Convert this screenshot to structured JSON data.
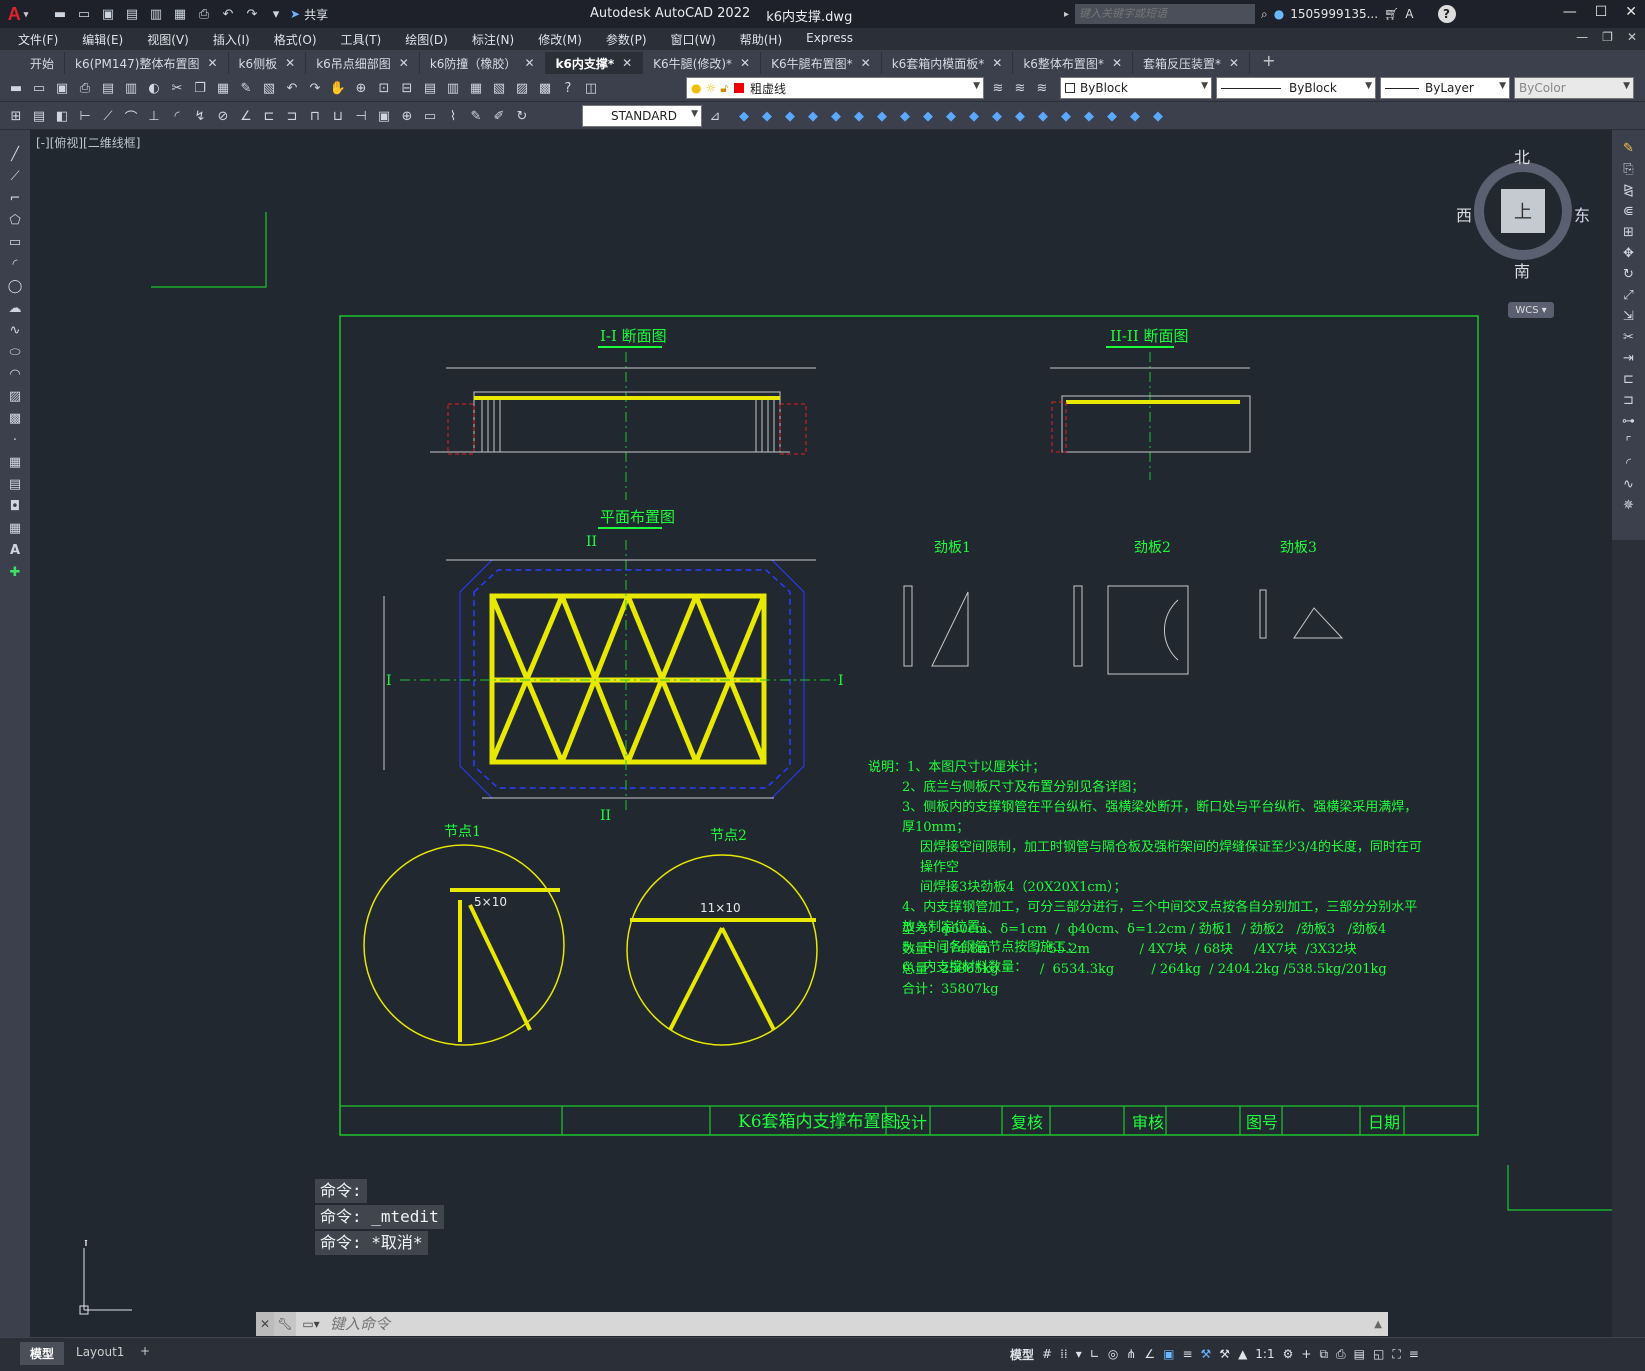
{
  "app": {
    "title": "Autodesk AutoCAD 2022",
    "file": "k6内支撑.dwg",
    "share": "共享",
    "search_placeholder": "键入关键字或短语",
    "user": "1505999135...",
    "help": "?"
  },
  "menus": [
    "文件(F)",
    "编辑(E)",
    "视图(V)",
    "插入(I)",
    "格式(O)",
    "工具(T)",
    "绘图(D)",
    "标注(N)",
    "修改(M)",
    "参数(P)",
    "窗口(W)",
    "帮助(H)",
    "Express"
  ],
  "tabs": [
    {
      "label": "开始",
      "closable": false
    },
    {
      "label": "k6(PM147)整体布置图",
      "closable": true
    },
    {
      "label": "k6侧板",
      "closable": true
    },
    {
      "label": "k6吊点细部图",
      "closable": true
    },
    {
      "label": "k6防撞（橡胶）",
      "closable": true
    },
    {
      "label": "k6内支撑*",
      "closable": true,
      "active": true
    },
    {
      "label": "K6牛腿(修改)*",
      "closable": true
    },
    {
      "label": "K6牛腿布置图*",
      "closable": true
    },
    {
      "label": "k6套箱内模面板*",
      "closable": true
    },
    {
      "label": "k6整体布置图*",
      "closable": true
    },
    {
      "label": "套箱反压装置*",
      "closable": true
    }
  ],
  "toolbar": {
    "layer": "粗虚线",
    "color": "ByBlock",
    "linetype": "ByBlock",
    "lineweight": "ByLayer",
    "plotstyle": "ByColor",
    "textstyle": "STANDARD"
  },
  "viewport_label": "[-][俯视][二维线框]",
  "viewcube": {
    "north": "北",
    "south": "南",
    "east": "东",
    "west": "西",
    "top": "上",
    "wcs": "WCS"
  },
  "drawing": {
    "section1": "I-I 断面图",
    "section2": "II-II 断面图",
    "plan": "平面布置图",
    "rib1": "劲板1",
    "rib2": "劲板2",
    "rib3": "劲板3",
    "node1": "节点1",
    "node2": "节点2",
    "node1_label": "5×10",
    "node2_label": "11×10",
    "label_roman1": "I",
    "label_roman2": "II",
    "notes": [
      "说明：1、本图尺寸以厘米计；",
      "2、底兰与侧板尺寸及布置分别见各详图；",
      "3、侧板内的支撑钢管在平台纵桁、强横梁处断开，断口处与平台纵桁、强横梁采用满焊，厚10mm；",
      "因焊接空间限制，加工时钢管与隔仓板及强桁架间的焊缝保证至少3/4的长度，同时在可操作空",
      "间焊接3块劲板4（20X20X1cm）；",
      "4、内支撑钢管加工，可分三部分进行，三个中间交叉点按各自分别加工，三部分分别水平放入制定位置；",
      "5、中间各钢管节点按图施工；",
      "6、内支撑材料数量："
    ],
    "table_rows": [
      "型号：ф60cm、δ=1cm  /  ф40cm、δ=1.2cm / 劲板1  / 劲板2   /劲板3   /劲板4",
      "数量：174.8m           /  55.2m            / 4X7块  / 68块     /4X7块  /3X32块",
      "总量：25865kg          /  6534.3kg         / 264kg  / 2404.2kg /538.5kg/201kg",
      "合计：35807kg"
    ],
    "title_block": {
      "name": "K6套箱内支撑布置图",
      "design": "设计",
      "review": "复核",
      "audit": "审核",
      "drawing_no": "图号",
      "date": "日期"
    }
  },
  "command": {
    "history": [
      "命令:",
      "命令: _mtedit",
      "命令: *取消*"
    ],
    "placeholder": "键入命令"
  },
  "layout_tabs": [
    "模型",
    "Layout1"
  ],
  "status": {
    "model": "模型",
    "scale": "1:1"
  }
}
